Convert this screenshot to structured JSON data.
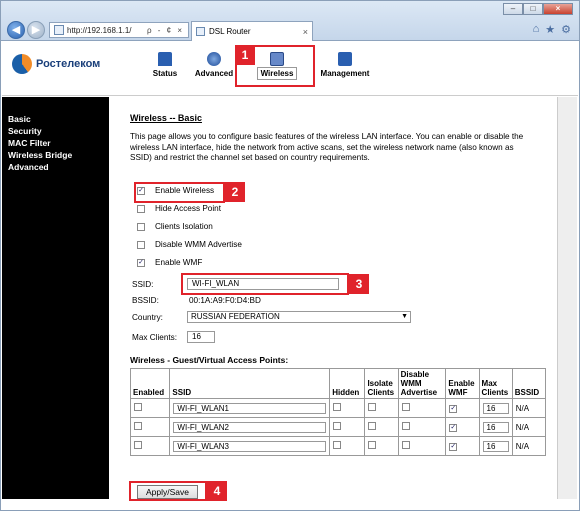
{
  "browser": {
    "url": "http://192.168.1.1/",
    "address_tools": "ρ - ¢ ×",
    "tab_title": "DSL Router",
    "tab_close": "×",
    "win_min": "–",
    "win_max": "□",
    "win_close": "×",
    "back": "◀",
    "fwd": "▶",
    "right_icons": [
      "⌂",
      "★",
      "⚙"
    ]
  },
  "router": {
    "logo_text": "Ростелеком",
    "nav": {
      "status": "Status",
      "advanced": "Advanced",
      "wireless": "Wireless",
      "management": "Management"
    }
  },
  "sidebar": {
    "items": [
      {
        "label": "Basic"
      },
      {
        "label": "Security"
      },
      {
        "label": "MAC Filter"
      },
      {
        "label": "Wireless Bridge"
      },
      {
        "label": "Advanced"
      }
    ]
  },
  "page": {
    "title": "Wireless -- Basic",
    "description": "This page allows you to configure basic features of the wireless LAN interface. You can enable or disable the wireless LAN interface, hide the network from active scans, set the wireless network name (also known as SSID) and restrict the channel set based on country requirements.",
    "checkboxes": [
      {
        "label": "Enable Wireless",
        "checked": true
      },
      {
        "label": "Hide Access Point",
        "checked": false
      },
      {
        "label": "Clients Isolation",
        "checked": false
      },
      {
        "label": "Disable WMM Advertise",
        "checked": false
      },
      {
        "label": "Enable WMF",
        "checked": true
      }
    ],
    "ssid_label": "SSID:",
    "ssid_value": "WI-FI_WLAN",
    "bssid_label": "BSSID:",
    "bssid_value": "00:1A:A9:F0:D4:BD",
    "country_label": "Country:",
    "country_value": "RUSSIAN FEDERATION",
    "max_clients_label": "Max Clients:",
    "max_clients_value": "16",
    "guest_title": "Wireless - Guest/Virtual Access Points:",
    "table": {
      "headers": [
        "Enabled",
        "SSID",
        "Hidden",
        "Isolate Clients",
        "Disable WMM Advertise",
        "Enable WMF",
        "Max Clients",
        "BSSID"
      ],
      "rows": [
        {
          "enabled": false,
          "ssid": "WI-FI_WLAN1",
          "hidden": false,
          "isolate": false,
          "wmm": false,
          "wmf": true,
          "max": "16",
          "bssid": "N/A"
        },
        {
          "enabled": false,
          "ssid": "WI-FI_WLAN2",
          "hidden": false,
          "isolate": false,
          "wmm": false,
          "wmf": true,
          "max": "16",
          "bssid": "N/A"
        },
        {
          "enabled": false,
          "ssid": "WI-FI_WLAN3",
          "hidden": false,
          "isolate": false,
          "wmm": false,
          "wmf": true,
          "max": "16",
          "bssid": "N/A"
        }
      ]
    },
    "apply_label": "Apply/Save"
  },
  "callouts": [
    "1",
    "2",
    "3",
    "4"
  ],
  "colors": {
    "callout": "#e0232b",
    "sidebar": "#000000"
  },
  "icons": {
    "back": "back-arrow-icon",
    "forward": "forward-arrow-icon",
    "page": "page-icon",
    "home": "home-icon",
    "favorites": "star-icon",
    "tools": "gear-icon"
  }
}
